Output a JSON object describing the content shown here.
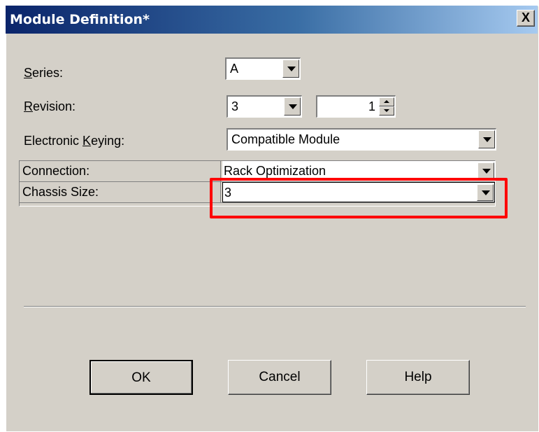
{
  "dialog": {
    "title": "Module Definition*",
    "close_label": "X"
  },
  "fields": {
    "series": {
      "label_first": "S",
      "label_rest": "eries:",
      "value": "A"
    },
    "revision": {
      "label_first": "R",
      "label_rest": "evision:",
      "major": "3",
      "minor": "1"
    },
    "keying": {
      "label_pre": "Electronic ",
      "label_u": "K",
      "label_post": "eying:",
      "value": "Compatible Module"
    }
  },
  "grid": {
    "rows": [
      {
        "label": "Connection:",
        "value": "Rack Optimization"
      },
      {
        "label": "Chassis Size:",
        "value": "3"
      }
    ]
  },
  "buttons": {
    "ok": "OK",
    "cancel": "Cancel",
    "help": "Help"
  },
  "colors": {
    "highlight": "#ff0000",
    "title_gradient_start": "#0a246a",
    "title_gradient_end": "#a6caf0",
    "dialog_bg": "#d4d0c8"
  }
}
